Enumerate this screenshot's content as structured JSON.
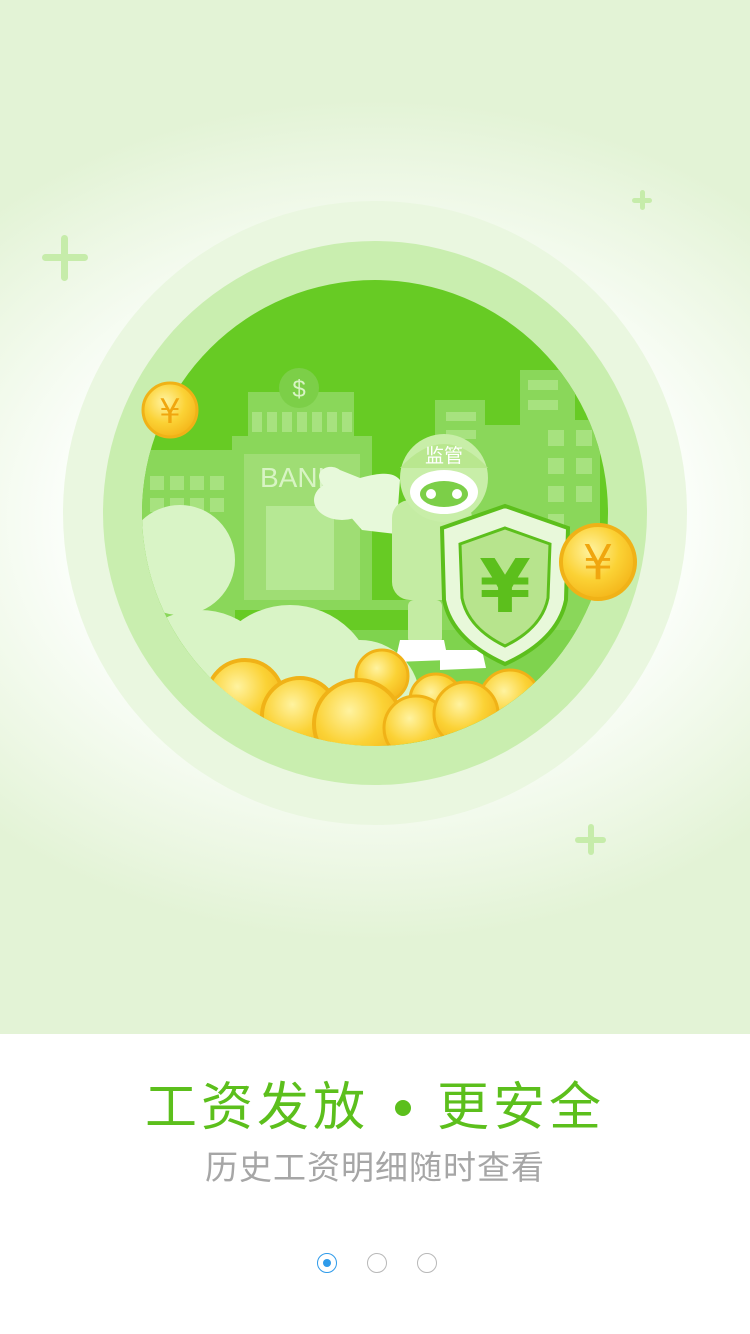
{
  "onboarding": {
    "title_left": "工资发放",
    "title_right": "更安全",
    "subtitle": "历史工资明细随时查看",
    "page_count": 3,
    "current_page": 1
  },
  "illustration": {
    "bank_sign": "BANK",
    "dollar_sign": "$",
    "helmet_label": "监管",
    "yuan_symbol": "¥"
  },
  "colors": {
    "accent_green": "#5cbf1c",
    "subtitle_gray": "#a6a6a6",
    "pager_active": "#2f9bea",
    "coin_gold": "#fbd235"
  }
}
